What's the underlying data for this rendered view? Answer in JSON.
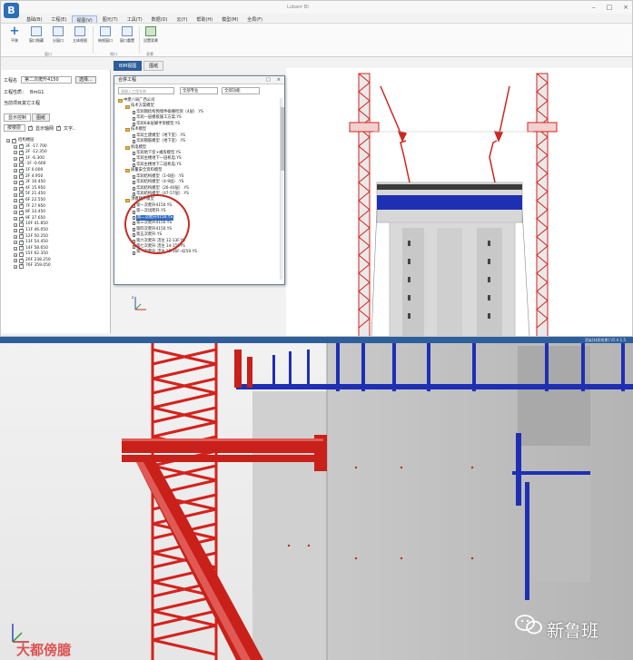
{
  "app": {
    "logo_letter": "B",
    "window_title": "Lubanr BI",
    "window_controls": [
      "–",
      "□",
      "×"
    ],
    "menu": [
      "基础(B)",
      "工程(E)",
      "视图(V)",
      "图元(T)",
      "工具(T)",
      "数据(D)",
      "云(Y)",
      "帮助(H)",
      "模型(M)",
      "全局(F)"
    ],
    "active_menu_index": 2
  },
  "ribbon": {
    "buttons": [
      {
        "label": "平移",
        "icon": "plus-icon"
      },
      {
        "label": "窗口隐藏",
        "icon": "window-icon"
      },
      {
        "label": "分窗口",
        "icon": "split-window-icon"
      },
      {
        "label": "立体视图",
        "icon": "3d-view-icon"
      },
      {
        "label": "俯视窗口",
        "icon": "top-view-icon"
      },
      {
        "label": "窗口重置",
        "icon": "reset-window-icon"
      },
      {
        "label": "设置背景",
        "icon": "background-icon"
      }
    ],
    "groups": [
      "窗口",
      "视口",
      "背景"
    ]
  },
  "view_tabs": [
    "BIM视图",
    "图纸"
  ],
  "left_panel": {
    "project_label": "工程名",
    "project_value": "第二次爬升4150",
    "select_btn": "选择...",
    "property_label": "工程性质：",
    "property_value": "BmG1",
    "link_label": "当前项目其它工程",
    "tabs": [
      "显示控制",
      "图纸"
    ],
    "view_select": "按楼层",
    "show_axis": "显示轴网",
    "show_text": "文字..",
    "floors": [
      "结构楼层",
      "3F -17.700",
      "2F -12.350",
      "1F -6.300",
      "-1F -0.600",
      "1F 0.000",
      "2F 4.950",
      "3F 10.450",
      "4F 15.950",
      "5F 21.450",
      "6F 22.550",
      "7F 27.950",
      "8F 33.450",
      "9F 37.650",
      "10F 41.850",
      "11F 46.050",
      "12F 50.250",
      "13F 54.450",
      "14F 58.650",
      "15F 62.350",
      "20F 238.250",
      "76F 359.050"
    ]
  },
  "dialog": {
    "title": "合併工程",
    "controls": [
      "□",
      "×"
    ],
    "search_placeholder": "请输入工程名称",
    "combo1": "全部专业",
    "combo2": "全部功能",
    "tree": [
      {
        "level": 0,
        "type": "folder",
        "label": "中建八局广西公司"
      },
      {
        "level": 1,
        "type": "folder",
        "label": "技术方案模型"
      },
      {
        "level": 2,
        "type": "doc",
        "label": "华润钢结构预埋件碰撞检测（4层）.YS"
      },
      {
        "level": 2,
        "type": "doc",
        "label": "华润—层模板施工方案.YS"
      },
      {
        "level": 2,
        "type": "doc",
        "label": "华润6米层脚手架模型.YS"
      },
      {
        "level": 1,
        "type": "folder",
        "label": "技术模型"
      },
      {
        "level": 2,
        "type": "doc",
        "label": "华润土建模型（地下室）.YS"
      },
      {
        "level": 2,
        "type": "doc",
        "label": "华润钢筋模型（地下室）.YS"
      },
      {
        "level": 1,
        "type": "folder",
        "label": "机电模型"
      },
      {
        "level": 2,
        "type": "doc",
        "label": "华润地下室+裙房模型.YS"
      },
      {
        "level": 2,
        "type": "doc",
        "label": "华润主楼地下一层机电.YS"
      },
      {
        "level": 2,
        "type": "doc",
        "label": "华润主楼地下二层机电.YS"
      },
      {
        "level": 1,
        "type": "folder",
        "label": "质量安全资料模型"
      },
      {
        "level": 2,
        "type": "doc",
        "label": "华润结构模型（1-6层）.YS"
      },
      {
        "level": 2,
        "type": "doc",
        "label": "华润结构模型（4-9层）.YS"
      },
      {
        "level": 2,
        "type": "doc",
        "label": "华润结构模型（26-40层）.YS"
      },
      {
        "level": 2,
        "type": "doc",
        "label": "华润结构模型（47-57层）.YS"
      },
      {
        "level": 1,
        "type": "folder",
        "label": "顶模爬升模型"
      },
      {
        "level": 2,
        "type": "doc",
        "label": "第一次爬升4150.YS"
      },
      {
        "level": 2,
        "type": "doc",
        "label": "第一次试爬升.YS"
      },
      {
        "level": 2,
        "type": "doc",
        "label": "第二次爬升4150.YS",
        "selected": true
      },
      {
        "level": 2,
        "type": "doc",
        "label": "第三次爬升4150.YS"
      },
      {
        "level": 2,
        "type": "doc",
        "label": "第四次爬升4150.YS"
      },
      {
        "level": 2,
        "type": "doc",
        "label": "第五次爬升.YS"
      },
      {
        "level": 2,
        "type": "doc",
        "label": "第六次爬升 浇注 12-13F.YS"
      },
      {
        "level": 2,
        "type": "doc",
        "label": "第七次爬升 浇注 14-15F.YS"
      },
      {
        "level": 2,
        "type": "doc",
        "label": "第八次爬升 浇注 15-16F-4250.YS"
      }
    ]
  },
  "render_bar_text": "渲染[材质效果]    V5.0.1.5",
  "watermarks": {
    "left": "大都傍臆",
    "right": "新鲁班"
  },
  "colors": {
    "accent_blue": "#2d5d9a",
    "crane_red": "#d4221c",
    "formwork_blue": "#1f2fb4",
    "highlight_red": "#c82a23"
  }
}
